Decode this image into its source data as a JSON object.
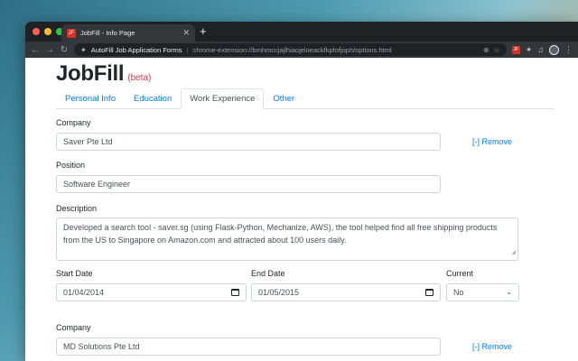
{
  "browser": {
    "tab_title": "JobFill - Info Page",
    "tab_favicon_text": "JF",
    "new_tab_symbol": "+",
    "extension_name": "AutoFill Job Application Forms",
    "url": "chrome-extension://bmhmccjajlhiaojeloeackfkpfofjoph/options.html",
    "colors": {
      "chrome_dark": "#202124",
      "chrome_mid": "#35363a",
      "favicon": "#d93025"
    }
  },
  "header": {
    "title": "JobFill",
    "badge": "(beta)"
  },
  "tabs": [
    {
      "label": "Personal Info",
      "active": false
    },
    {
      "label": "Education",
      "active": false
    },
    {
      "label": "Work Experience",
      "active": true
    },
    {
      "label": "Other",
      "active": false
    }
  ],
  "experiences": [
    {
      "company_label": "Company",
      "company": "Saver Pte Ltd",
      "remove_label": "[-] Remove",
      "position_label": "Position",
      "position": "Software Engineer",
      "description_label": "Description",
      "description": "Developed a search tool - saver.sg (using Flask-Python, Mechanize, AWS), the tool helped find all free shipping products from the US to Singapore on Amazon.com and attracted about 100 users daily.",
      "start_label": "Start Date",
      "start_date": "01/04/2014",
      "end_label": "End Date",
      "end_date": "01/05/2015",
      "current_label": "Current",
      "current": "No"
    },
    {
      "company_label": "Company",
      "company": "MD Solutions Pte Ltd",
      "remove_label": "[-] Remove"
    }
  ],
  "colors": {
    "link": "#007bff",
    "beta": "#dc3545",
    "border": "#ced4da"
  }
}
